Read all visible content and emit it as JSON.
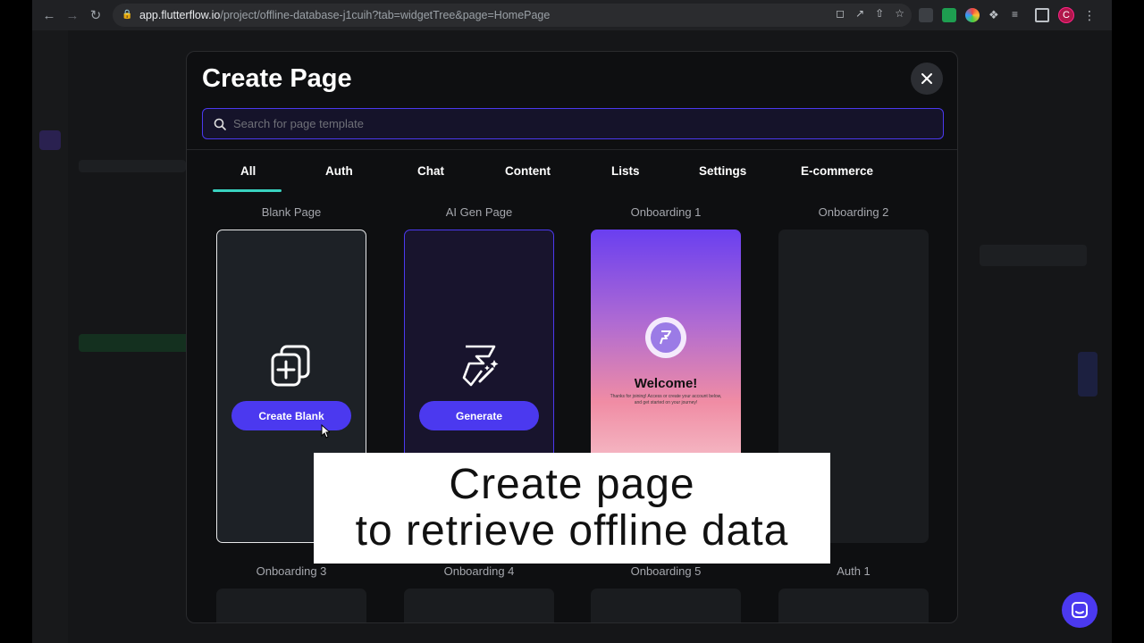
{
  "browser": {
    "url_host": "app.flutterflow.io",
    "url_path": "/project/offline-database-j1cuih?tab=widgetTree&page=HomePage",
    "profile_initial": "C"
  },
  "modal": {
    "title": "Create Page",
    "search_placeholder": "Search for page template",
    "close_icon": "close-icon",
    "tabs": [
      {
        "label": "All",
        "active": true
      },
      {
        "label": "Auth"
      },
      {
        "label": "Chat"
      },
      {
        "label": "Content"
      },
      {
        "label": "Lists"
      },
      {
        "label": "Settings"
      },
      {
        "label": "E-commerce"
      }
    ],
    "templates_row1": [
      {
        "label": "Blank Page",
        "button": "Create Blank",
        "icon": "add-page-icon"
      },
      {
        "label": "AI Gen Page",
        "button": "Generate",
        "icon": "ai-magic-icon"
      },
      {
        "label": "Onboarding 1",
        "preview_title": "Welcome!",
        "preview_text": "Thanks for joining! Access or create your account below, and get started on your journey!"
      },
      {
        "label": "Onboarding 2"
      }
    ],
    "templates_row2": [
      {
        "label": "Onboarding 3"
      },
      {
        "label": "Onboarding 4"
      },
      {
        "label": "Onboarding 5"
      },
      {
        "label": "Auth 1"
      }
    ]
  },
  "caption": {
    "line1": "Create page",
    "line2": "to retrieve offline data"
  },
  "colors": {
    "accent": "#4b39ef",
    "tab_underline": "#39d2c0"
  }
}
